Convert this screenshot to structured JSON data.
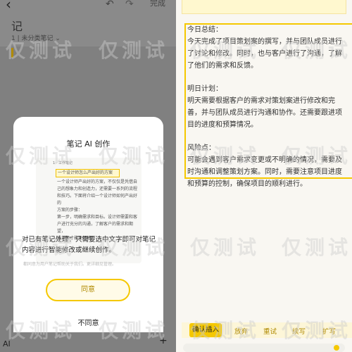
{
  "left_phone": {
    "header": {
      "back_icon": "back-chevron-icon",
      "undo_icon": "undo-icon",
      "redo_icon": "redo-icon",
      "done_label": "完成",
      "title": "记",
      "meta": "1 | 未分类笔记 ⌄"
    },
    "modal": {
      "title": "笔记 AI 创作",
      "preview": {
        "header": "1 · 工作笔记",
        "highlight": "一个设计师怎么产出好的方案",
        "body_lines": [
          "一个设计师产出好的方案，不仅仅是凭借自",
          "己的想象力和创造力，还需要一系列的流程",
          "和技巧。下面将介绍一个设计师如何产出好的",
          "方案的步骤：",
          "第一步，明确需求和目标。设计师需要和客",
          "户进行充分的沟通，了解客户的需求和期望，",
          "设计师才能更好地"
        ]
      },
      "description": "对已有笔记处理：只需要选中文字即可对笔记内容进行智能修改或继续创作。",
      "note": "都同意为用户笔记帮助关于我们。更详细见管理。",
      "agree_label": "同意",
      "disagree_label": "不同意"
    },
    "toolbar": {
      "ai_label": "AI",
      "plus_label": "+"
    }
  },
  "right_phone": {
    "note_sections": [
      {
        "heading": "今日总结：",
        "body": "今天完成了项目策划案的撰写，并与团队成员进行了讨论和修改。同时，也与客户进行了沟通，了解了他们的需求和反馈。"
      },
      {
        "heading": "明日计划：",
        "body": "明天需要根据客户的需求对策划案进行修改和完善，并与团队成员进行沟通和协作。还需要跟进项目的进度和预算情况。"
      },
      {
        "heading": "风险点：",
        "body": "可能会遇到客户需求变更或不明确的情况，需要及时沟通和调整策划方案。同时，需要注意项目进度和预算的控制，确保项目的顺利进行。"
      }
    ],
    "actions": {
      "keep_label": "确认插入",
      "discard_label": "放弃",
      "retry_label": "重试",
      "continue_label": "续写",
      "expand_label": "扩写"
    }
  },
  "watermark": "仅测试",
  "colors": {
    "accent": "#f5c800",
    "accent_text": "#b08a00",
    "overlay": "#808080",
    "modal_bg": "#ffffff",
    "right_bg": "#f9f7f2"
  }
}
